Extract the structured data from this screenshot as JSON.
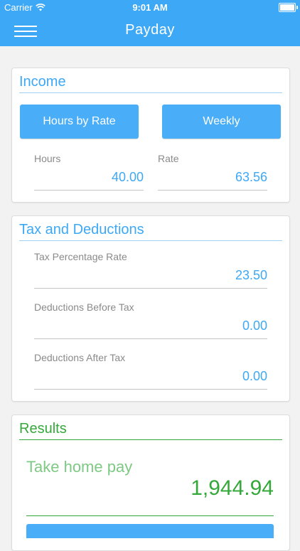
{
  "status_bar": {
    "carrier": "Carrier",
    "time": "9:01 AM"
  },
  "navbar": {
    "title": "Payday"
  },
  "income": {
    "title": "Income",
    "mode_button": "Hours by Rate",
    "period_button": "Weekly",
    "hours_label": "Hours",
    "hours_value": "40.00",
    "rate_label": "Rate",
    "rate_value": "63.56"
  },
  "tax": {
    "title": "Tax and Deductions",
    "tax_rate_label": "Tax Percentage Rate",
    "tax_rate_value": "23.50",
    "deductions_before_label": "Deductions Before Tax",
    "deductions_before_value": "0.00",
    "deductions_after_label": "Deductions After Tax",
    "deductions_after_value": "0.00"
  },
  "results": {
    "title": "Results",
    "take_home_label": "Take home pay",
    "take_home_value": "1,944.94"
  },
  "colors": {
    "accent_blue": "#3da8f5",
    "results_green": "#34a83a"
  }
}
